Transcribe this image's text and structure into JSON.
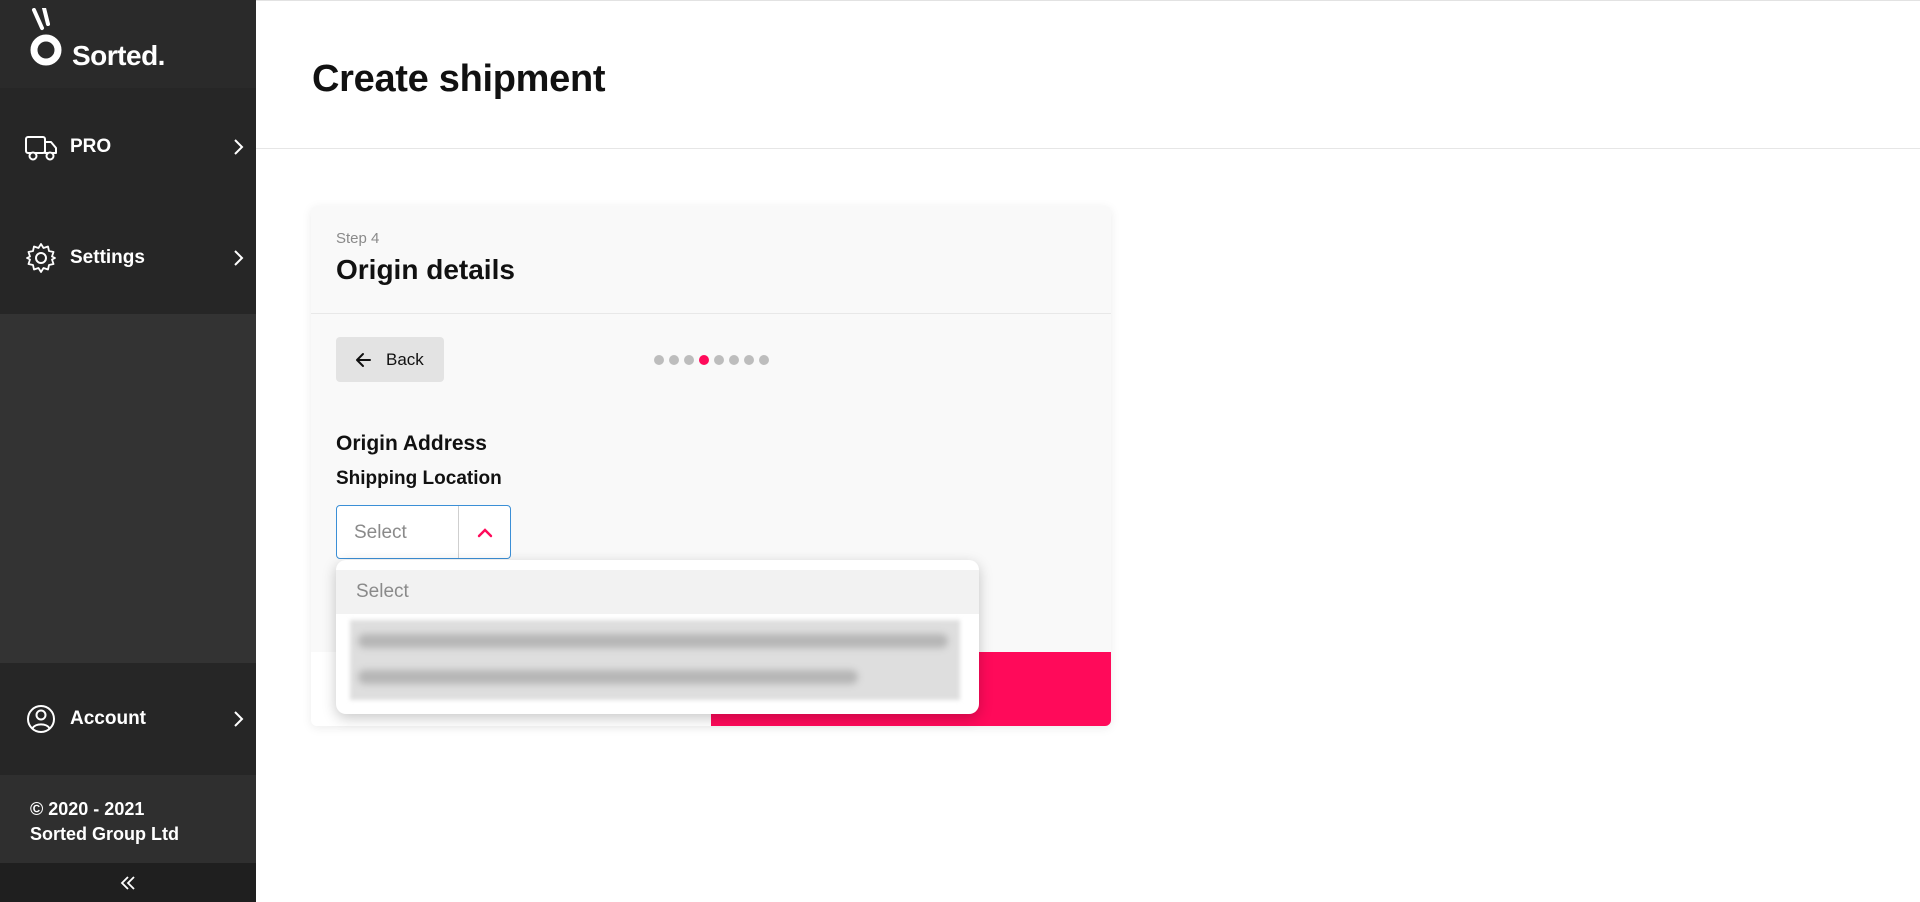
{
  "brand": {
    "name": "Sorted."
  },
  "sidebar": {
    "items": [
      {
        "label": "PRO",
        "icon": "truck-icon"
      },
      {
        "label": "Settings",
        "icon": "gear-icon"
      }
    ],
    "account": {
      "label": "Account",
      "icon": "user-circle-icon"
    },
    "copyright_line1": "© 2020 - 2021",
    "copyright_line2": "Sorted Group Ltd",
    "collapse_icon": "double-chevron-left-icon"
  },
  "header": {
    "title": "Create shipment"
  },
  "card": {
    "step_label": "Step 4",
    "title": "Origin details",
    "back_label": "Back",
    "progress": {
      "total_steps": 8,
      "current_step": 4
    },
    "section_title": "Origin Address",
    "field_label": "Shipping Location",
    "select_value": "Select"
  },
  "dropdown": {
    "options": [
      "Select"
    ]
  },
  "colors": {
    "accent": "#ff0a5a",
    "sidebar_bg": "#333333",
    "focus_border": "#3b8fd6"
  }
}
